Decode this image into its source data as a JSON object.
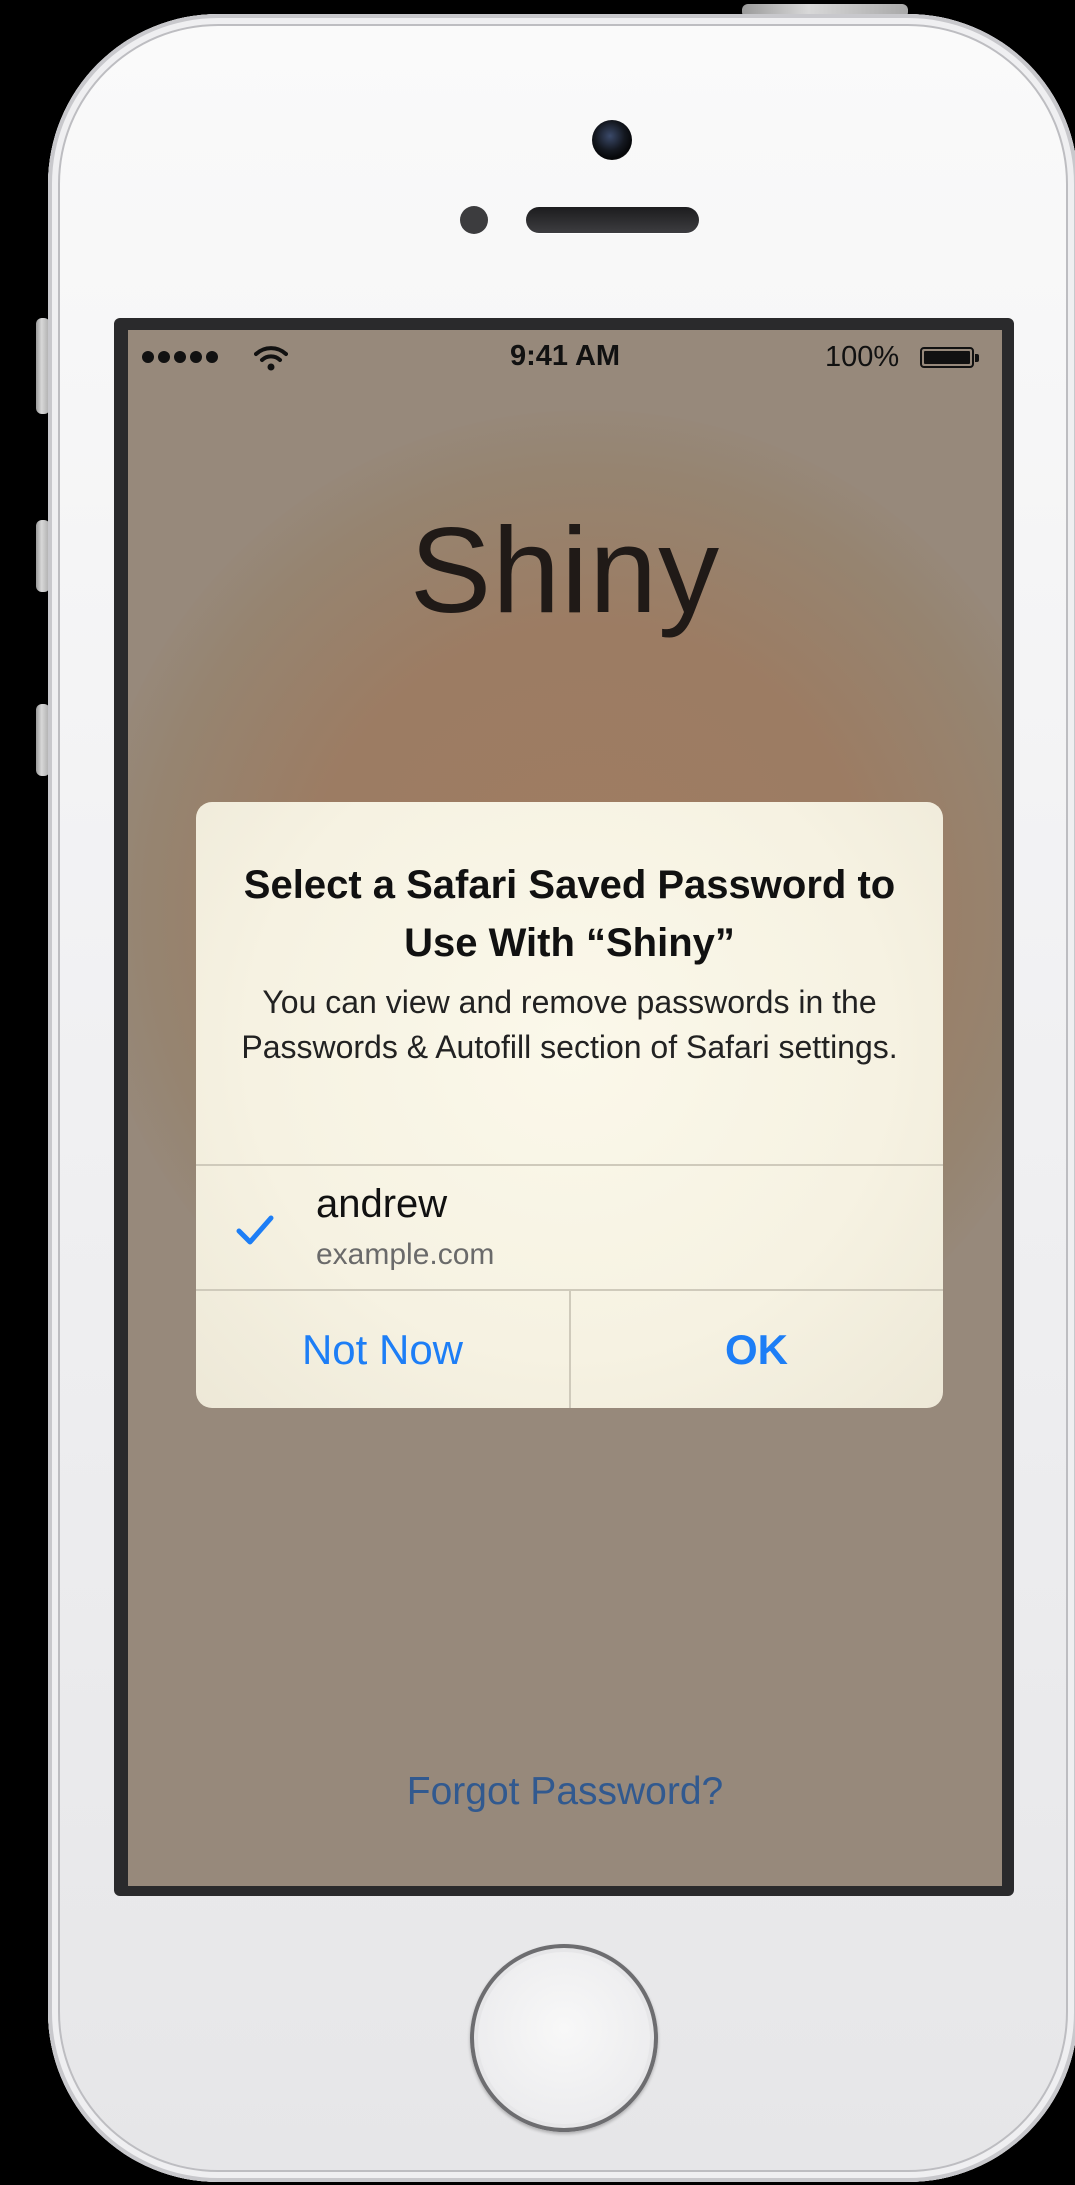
{
  "status_bar": {
    "time": "9:41 AM",
    "battery_percent": "100%",
    "signal_icon": "signal-dots-icon",
    "wifi_icon": "wifi-icon",
    "battery_icon": "battery-icon"
  },
  "app": {
    "title": "Shiny",
    "forgot_password": "Forgot Password?"
  },
  "alert": {
    "title": "Select a Safari Saved Password to Use With “Shiny”",
    "message": "You can view and remove passwords in the Passwords & Autofill section of Safari settings.",
    "credential": {
      "username": "andrew",
      "site": "example.com",
      "selected": true,
      "check_icon": "checkmark-icon"
    },
    "buttons": {
      "not_now": "Not Now",
      "ok": "OK"
    }
  },
  "colors": {
    "accent_blue": "#1d7ef6",
    "link_blue": "#31598f",
    "screen_background": "#97897b"
  }
}
